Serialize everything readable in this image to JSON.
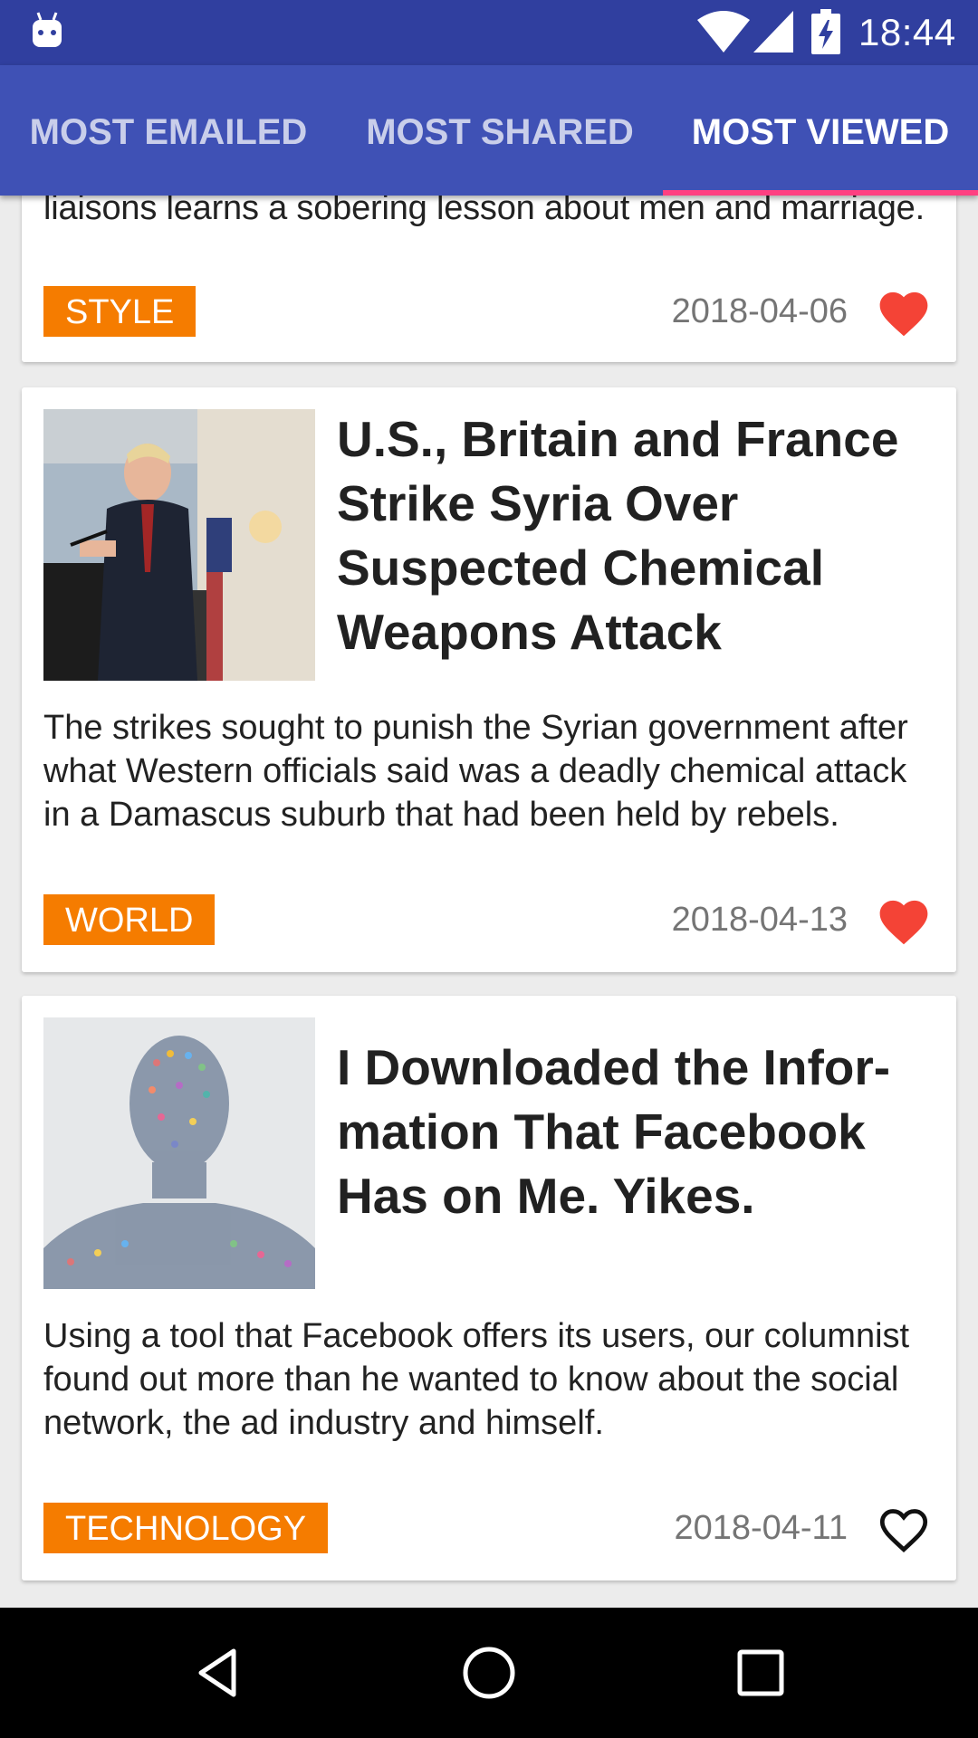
{
  "status_bar": {
    "time": "18:44",
    "icons": [
      "android-icon",
      "wifi-icon",
      "signal-icon",
      "battery-charging-icon"
    ]
  },
  "tabs": [
    {
      "label": "MOST EMAILED",
      "active": false
    },
    {
      "label": "MOST SHARED",
      "active": false
    },
    {
      "label": "MOST VIEWED",
      "active": true
    }
  ],
  "articles": [
    {
      "summary": "liaisons learns a sobering lesson about men and marriage.",
      "section": "STYLE",
      "date": "2018-04-06",
      "favorite": true
    },
    {
      "title": "U.S., Britain and France Strike Syria Over Suspected Chemical Weapons Attack",
      "summary": "The strikes sought to punish the Syrian government after what Western officials said was a deadly chemical attack in a Damascus suburb that had been held by rebels.",
      "section": "WORLD",
      "date": "2018-04-13",
      "favorite": true
    },
    {
      "title": "I Downloaded the Infor­mation That Facebook Has on Me. Yikes.",
      "summary": "Using a tool that Facebook offers its users, our columnist found out more than he wanted to know about the social network, the ad industry and himself.",
      "section": "TECHNOLOGY",
      "date": "2018-04-11",
      "favorite": false
    }
  ],
  "colors": {
    "status_bar": "#303f9f",
    "toolbar": "#3f51b5",
    "tab_indicator": "#ff4081",
    "section_tag": "#f57c00",
    "heart_filled": "#f44336"
  },
  "nav_bar": [
    "back-icon",
    "home-icon",
    "recents-icon"
  ]
}
